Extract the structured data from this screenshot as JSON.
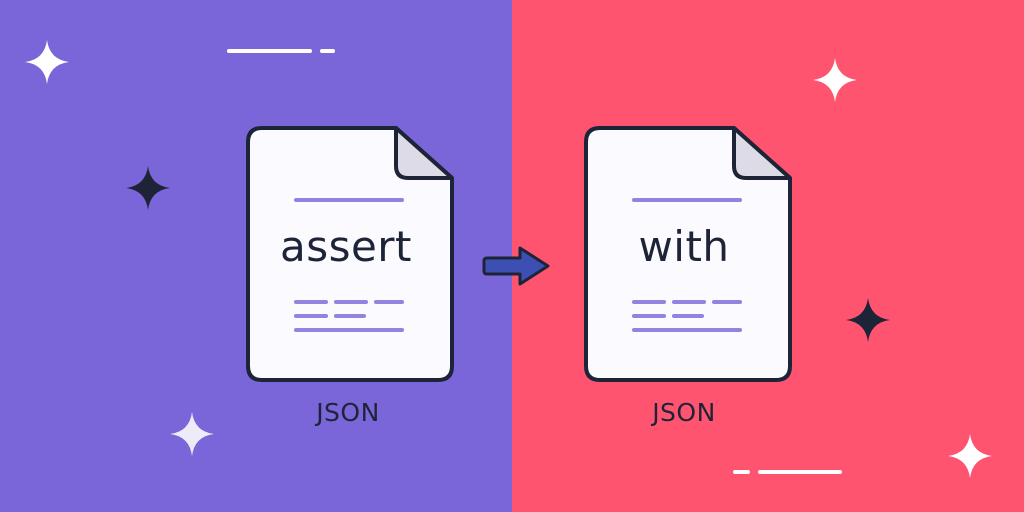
{
  "colors": {
    "left_background": "#7a66d9",
    "right_background": "#ff5470",
    "document_fill": "#fbfbff",
    "outline": "#1e2438",
    "text_lines": "#9283e0",
    "arrow": "#3d4fb3"
  },
  "source_file": {
    "keyword": "assert",
    "format_label": "JSON",
    "icon": "document-icon"
  },
  "target_file": {
    "keyword": "with",
    "format_label": "JSON",
    "icon": "document-icon"
  },
  "connector": {
    "icon": "right-arrow-icon"
  },
  "decorations": {
    "sparkles": [
      "sparkle-icon",
      "sparkle-icon",
      "sparkle-icon",
      "sparkle-icon",
      "sparkle-icon",
      "sparkle-icon"
    ]
  }
}
